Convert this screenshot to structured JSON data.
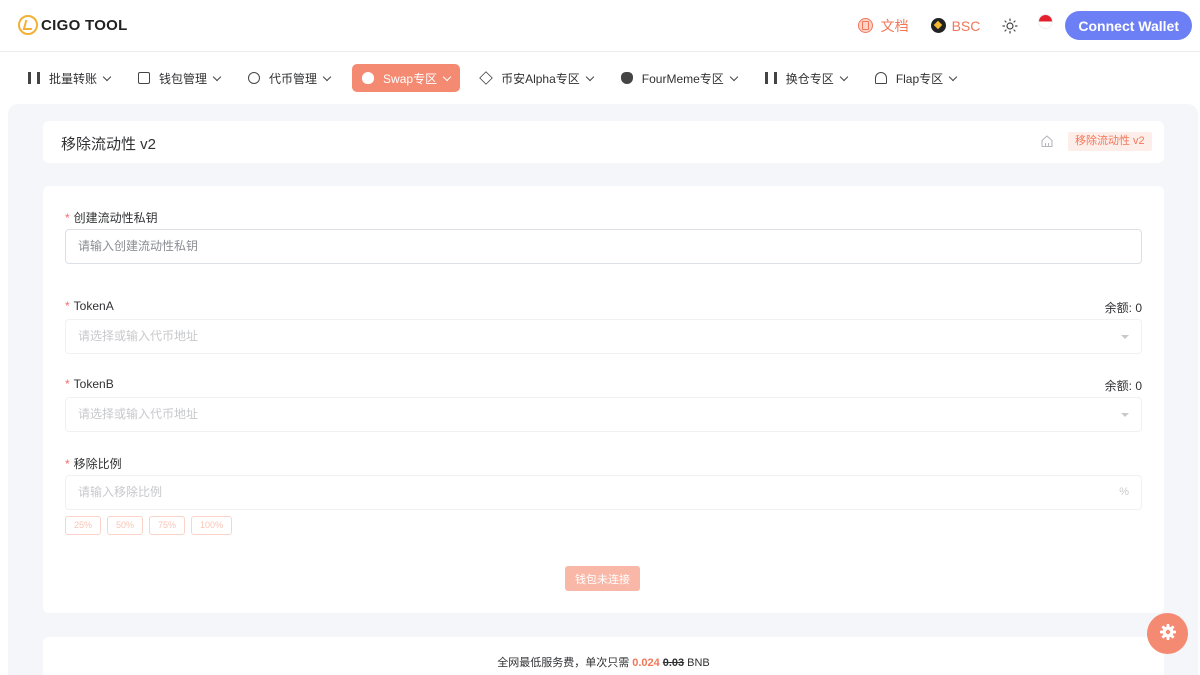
{
  "header": {
    "logo_text": "CIGO TOOL",
    "docs_label": "文档",
    "chain_label": "BSC",
    "connect_label": "Connect Wallet"
  },
  "nav": {
    "items": [
      {
        "label": "批量转账",
        "icon": "transfer-icon"
      },
      {
        "label": "钱包管理",
        "icon": "wallet-icon"
      },
      {
        "label": "代币管理",
        "icon": "coin-icon"
      },
      {
        "label": "Swap专区",
        "icon": "swap-icon",
        "active": true
      },
      {
        "label": "币安Alpha专区",
        "icon": "binance-icon"
      },
      {
        "label": "FourMeme专区",
        "icon": "fourmeme-icon"
      },
      {
        "label": "换仓专区",
        "icon": "exchange-icon"
      },
      {
        "label": "Flap专区",
        "icon": "flap-icon"
      }
    ]
  },
  "page": {
    "title": "移除流动性 v2",
    "breadcrumb": "移除流动性 v2"
  },
  "form": {
    "private_key": {
      "label": "创建流动性私钥",
      "placeholder": "请输入创建流动性私钥"
    },
    "token_a": {
      "label": "TokenA",
      "placeholder": "请选择或输入代币地址",
      "balance_label": "余额:",
      "balance": "0"
    },
    "token_b": {
      "label": "TokenB",
      "placeholder": "请选择或输入代币地址",
      "balance_label": "余额:",
      "balance": "0"
    },
    "ratio": {
      "label": "移除比例",
      "placeholder": "请输入移除比例",
      "suffix": "%",
      "presets": [
        "25%",
        "50%",
        "75%",
        "100%"
      ]
    },
    "submit_label": "钱包未连接"
  },
  "fee": {
    "prefix": "全网最低服务费，单次只需",
    "price": "0.024",
    "old_price": "0.03",
    "unit": "BNB"
  },
  "colors": {
    "accent": "#f58a73",
    "connect": "#6d7ff5"
  }
}
